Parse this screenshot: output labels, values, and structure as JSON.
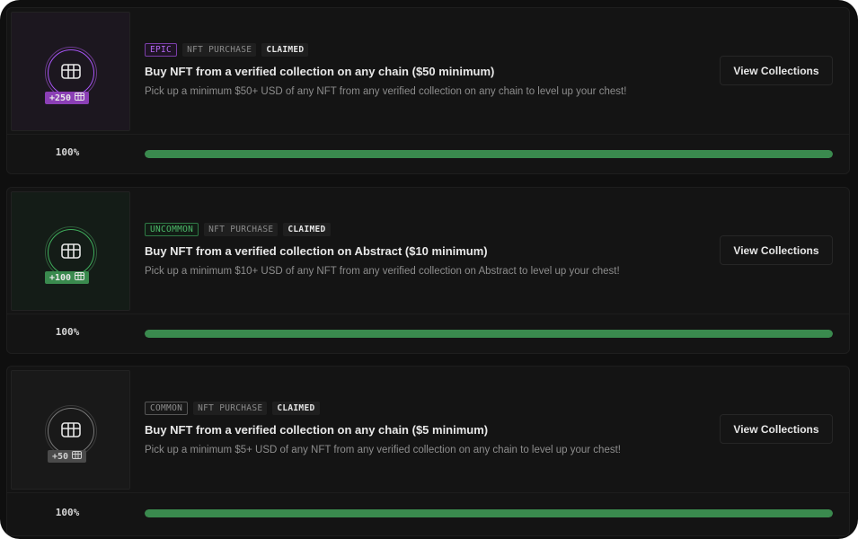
{
  "quests": [
    {
      "rarity": "EPIC",
      "rarity_color": "#a855f7",
      "type": "NFT PURCHASE",
      "status": "CLAIMED",
      "points": "+250",
      "title": "Buy NFT from a verified collection on any chain ($50 minimum)",
      "description": "Pick up a minimum $50+ USD of any NFT from any verified collection on any chain to level up your chest!",
      "cta_label": "View Collections",
      "progress_label": "100%",
      "progress_fraction": 1.0
    },
    {
      "rarity": "UNCOMMON",
      "rarity_color": "#3fae5c",
      "type": "NFT PURCHASE",
      "status": "CLAIMED",
      "points": "+100",
      "title": "Buy NFT from a verified collection on Abstract ($10 minimum)",
      "description": "Pick up a minimum $10+ USD of any NFT from any verified collection on Abstract to level up your chest!",
      "cta_label": "View Collections",
      "progress_label": "100%",
      "progress_fraction": 1.0
    },
    {
      "rarity": "COMMON",
      "rarity_color": "#8c8c8c",
      "type": "NFT PURCHASE",
      "status": "CLAIMED",
      "points": "+50",
      "title": "Buy NFT from a verified collection on any chain ($5 minimum)",
      "description": "Pick up a minimum $5+ USD of any NFT from any verified collection on any chain to level up your chest!",
      "cta_label": "View Collections",
      "progress_label": "100%",
      "progress_fraction": 1.0
    }
  ],
  "icons": {
    "reward": "chest-icon",
    "points": "chest-icon"
  },
  "colors": {
    "progress": "#3a8a4e",
    "background": "#0f0f0f",
    "card": "#141414"
  }
}
